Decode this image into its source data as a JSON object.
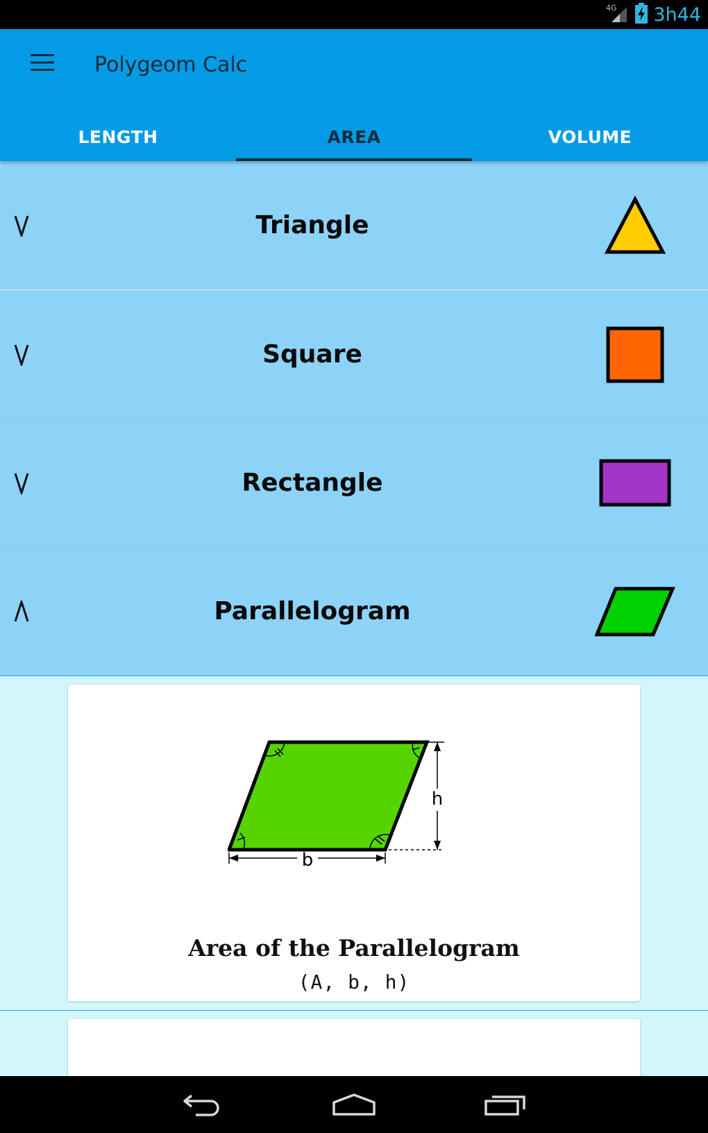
{
  "status": {
    "network": "4G",
    "time": "3h44"
  },
  "app": {
    "title": "Polygeom Calc"
  },
  "tabs": [
    {
      "label": "LENGTH",
      "active": false
    },
    {
      "label": "AREA",
      "active": true
    },
    {
      "label": "VOLUME",
      "active": false
    }
  ],
  "shapes": [
    {
      "label": "Triangle",
      "expanded": false,
      "color": "#ffcc00",
      "icon": "triangle-icon"
    },
    {
      "label": "Square",
      "expanded": false,
      "color": "#ff6600",
      "icon": "square-icon"
    },
    {
      "label": "Rectangle",
      "expanded": false,
      "color": "#a335c8",
      "icon": "rectangle-icon"
    },
    {
      "label": "Parallelogram",
      "expanded": true,
      "color": "#00d100",
      "icon": "parallelogram-icon"
    }
  ],
  "card": {
    "title": "Area of the Parallelogram",
    "subtitle": "(A, b, h)",
    "figure": {
      "base_label": "b",
      "height_label": "h",
      "fill": "#55d400"
    }
  },
  "colors": {
    "app_bar": "#039be5",
    "row_bg": "#8dd3f8",
    "content_bg": "#d2f6fb",
    "status_time": "#33b5e5"
  }
}
